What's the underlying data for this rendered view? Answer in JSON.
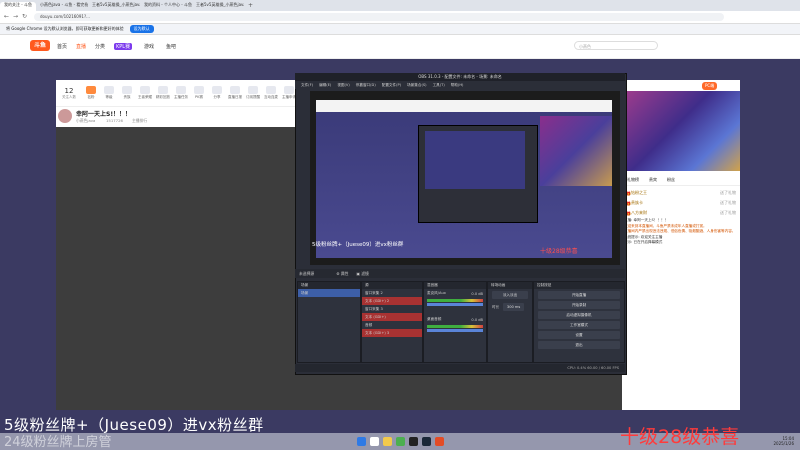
{
  "browser": {
    "tabs": [
      "我的关注 - 斗鱼",
      "小燕色java - 斗鱼 - 看完视频",
      "王者5v5英雄操_小燕色java直",
      "我的资料 - 个人中心 - 斗鱼",
      "王者5v5英雄操_小燕色java直"
    ],
    "url": "douyu.com/10216091?...",
    "infobar_text": "将 Google Chrome 设为默认浏览器，即可获取更新和更好的体验",
    "infobar_button": "设为默认"
  },
  "site": {
    "logo": "斗鱼",
    "nav": [
      "首页",
      "直播",
      "分类",
      "KPL赛",
      "游戏",
      "鱼吧"
    ],
    "search_placeholder": "小燕色"
  },
  "room": {
    "fans_count": "12",
    "fans_label": "关注人数",
    "icons": [
      "钻粉",
      "等级",
      "贵族",
      "王者荣耀",
      "精彩回放",
      "主播任务",
      "PK赛",
      "分享",
      "直播日报",
      "订阅提醒",
      "互动连麦",
      "主播申请",
      "相关推荐"
    ],
    "stream_title": "幸阿一天上S!！！！",
    "host": "小燕色java",
    "viewers": "1517726",
    "followers": "主播排行",
    "tags": [
      "关注"
    ]
  },
  "obs": {
    "title": "OBS 31.0.3 - 配置文件: 未命名 - 场景: 未命名",
    "menu": [
      "文件(F)",
      "编辑(E)",
      "视图(V)",
      "停靠窗口(D)",
      "配置文件(P)",
      "场景集合(S)",
      "工具(T)",
      "帮助(H)"
    ],
    "preview_caption": "5级粉丝牌+（Juese09）进vx粉丝群",
    "preview_caption_right": "十级28级恭喜",
    "scene_bar": [
      "未选择源",
      "属性",
      "滤镜"
    ],
    "docks": {
      "scenes": {
        "title": "场景",
        "items": [
          "场景"
        ]
      },
      "sources": {
        "title": "源",
        "items": [
          "窗口采集 2",
          "文本 (GDI+) 2",
          "窗口采集 3",
          "文本 (GDI+)",
          "音频",
          "文本 (GDI+) 3"
        ]
      },
      "mixer": {
        "title": "混音器",
        "channels": [
          "麦克风/Aux",
          "桌面音频"
        ],
        "levels": [
          "0.0 dB",
          "0.0 dB"
        ]
      },
      "transitions": {
        "title": "转场动画",
        "type": "淡入淡出",
        "duration_label": "时长",
        "duration": "300 ms"
      },
      "controls": {
        "title": "控制按钮",
        "buttons": [
          "开始直播",
          "开始录制",
          "启动虚拟摄像机",
          "工作室模式",
          "设置",
          "退出"
        ]
      }
    },
    "status": "CPU: 0.4%   60.00 / 60.00 FPS"
  },
  "right_panel": {
    "tabs": [
      "礼物榜",
      "贵宾",
      "粉丝"
    ],
    "gifts": [
      {
        "name": "钻粉之王",
        "note": "送了礼物"
      },
      {
        "name": "贵族卡",
        "note": "送了礼物"
      },
      {
        "name": "八方来财",
        "note": "送了礼物"
      }
    ],
    "chat": [
      "主播: 幸阿一天上S！！！！",
      "欢迎来到本直播间，斗鱼严禁未成年人直播或打赏。",
      "直播间内严禁出现违法违规、低俗色情、吸烟酗酒、人身伤害等内容。",
      "系统提示: 欢迎关注主播",
      "提示: 已在开启弹幕模式"
    ],
    "pc_badge": "PC端"
  },
  "overlay": {
    "line1": "5级粉丝牌+（Juese09）进vx粉丝群",
    "line2": "24级粉丝牌上房管",
    "line3": "十级28级恭喜"
  },
  "taskbar": {
    "time": "15:04",
    "date": "2025/1/26"
  }
}
